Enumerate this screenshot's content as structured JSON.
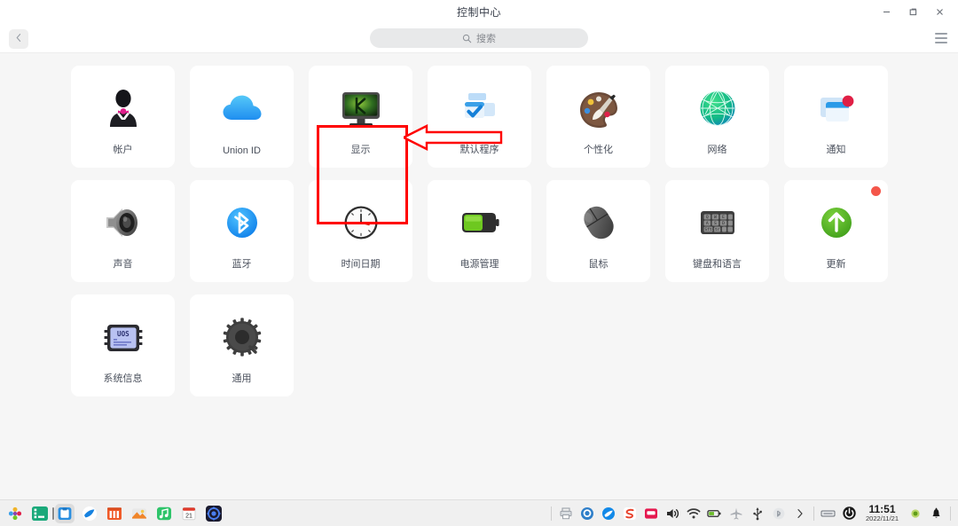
{
  "window": {
    "title": "控制中心",
    "controls": [
      {
        "name": "minimize",
        "glyph": "−"
      },
      {
        "name": "maximize",
        "glyph": "❐"
      },
      {
        "name": "close",
        "glyph": "✕"
      }
    ]
  },
  "toolbar": {
    "back_label": "‹",
    "back_icon": "chevron-left-icon",
    "menu_icon": "hamburger-menu-icon",
    "search": {
      "icon": "search-icon",
      "placeholder": "搜索",
      "value": ""
    }
  },
  "grid": {
    "tiles": [
      {
        "label": "帐户",
        "icon": "account-icon",
        "badge": false
      },
      {
        "label": "Union ID",
        "icon": "cloud-icon",
        "badge": false
      },
      {
        "label": "显示",
        "icon": "display-monitor-icon",
        "badge": false,
        "highlighted": true
      },
      {
        "label": "默认程序",
        "icon": "default-apps-icon",
        "badge": false
      },
      {
        "label": "个性化",
        "icon": "palette-icon",
        "badge": false
      },
      {
        "label": "网络",
        "icon": "globe-network-icon",
        "badge": false
      },
      {
        "label": "通知",
        "icon": "notification-icon",
        "badge": false
      },
      {
        "label": "声音",
        "icon": "speaker-icon",
        "badge": false
      },
      {
        "label": "蓝牙",
        "icon": "bluetooth-icon",
        "badge": false
      },
      {
        "label": "时间日期",
        "icon": "clock-icon",
        "badge": false
      },
      {
        "label": "电源管理",
        "icon": "battery-icon",
        "badge": false
      },
      {
        "label": "鼠标",
        "icon": "mouse-icon",
        "badge": false
      },
      {
        "label": "键盘和语言",
        "icon": "keyboard-icon",
        "badge": false
      },
      {
        "label": "更新",
        "icon": "update-arrow-icon",
        "badge": true
      },
      {
        "label": "系统信息",
        "icon": "uos-chip-icon",
        "badge": false,
        "chip_text": "UOS"
      },
      {
        "label": "通用",
        "icon": "gear-icon",
        "badge": false
      }
    ]
  },
  "annotation": {
    "highlight_target": "显示",
    "box_color": "#ff0000",
    "arrow_color": "#ff0000",
    "arrow_direction": "left"
  },
  "taskbar": {
    "apps": [
      {
        "name": "launcher-icon",
        "active": false
      },
      {
        "name": "terminal-icon",
        "active": false
      },
      {
        "name": "file-manager-icon",
        "active": true
      },
      {
        "name": "browser-icon",
        "active": false
      },
      {
        "name": "app-store-icon",
        "active": false
      },
      {
        "name": "image-viewer-icon",
        "active": false
      },
      {
        "name": "music-player-icon",
        "active": false
      },
      {
        "name": "calendar-icon",
        "active": false,
        "day": "21"
      },
      {
        "name": "control-center-icon",
        "active": false
      }
    ],
    "tray": [
      {
        "name": "printer-icon"
      },
      {
        "name": "chat-icon"
      },
      {
        "name": "browser-tray-icon"
      },
      {
        "name": "sogou-input-icon"
      },
      {
        "name": "screen-recorder-icon"
      },
      {
        "name": "volume-icon"
      },
      {
        "name": "wifi-icon"
      },
      {
        "name": "battery-tray-icon"
      },
      {
        "name": "airplane-mode-icon"
      },
      {
        "name": "usb-icon"
      },
      {
        "name": "bluetooth-tray-icon"
      },
      {
        "name": "expand-tray-icon"
      }
    ],
    "keyboard_icon": "keyboard-layout-icon",
    "power_icon": "power-icon",
    "clock": {
      "time": "11:51",
      "date": "2022/11/21"
    },
    "status_dot_color": "#7dbb2a",
    "notification_icon": "bell-icon"
  },
  "colors": {
    "accent": "#1c77e8",
    "badge_red": "#f4564a",
    "annotation_red": "#ff0000",
    "tile_bg": "#ffffff",
    "content_bg": "#f6f6f6"
  }
}
